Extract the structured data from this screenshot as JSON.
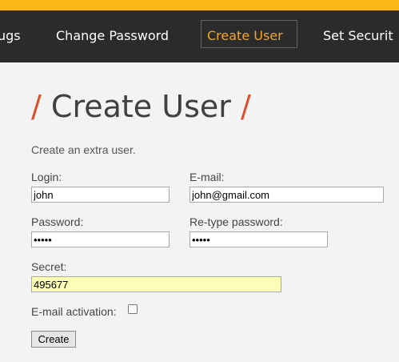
{
  "nav": {
    "items": [
      "ugs",
      "Change Password",
      "Create User",
      "Set Securit"
    ],
    "active": "Create User"
  },
  "page": {
    "title": "Create User",
    "title_slash": "/",
    "description": "Create an extra user."
  },
  "form": {
    "login_label": "Login:",
    "login_value": "john",
    "email_label": "E-mail:",
    "email_value": "john@gmail.com",
    "password_label": "Password:",
    "password_value": "•••••",
    "retype_label": "Re-type password:",
    "retype_value": "•••••",
    "secret_label": "Secret:",
    "secret_value": "495677",
    "activation_label": "E-mail activation:",
    "activation_checked": false,
    "create_label": "Create"
  },
  "colors": {
    "accent_bar": "#fbb819",
    "nav_bg": "#2b2b2b",
    "active_text": "#f5a623",
    "active_border": "#d9302a",
    "slash": "#d94f2b",
    "secret_bg": "#fdffb8"
  }
}
